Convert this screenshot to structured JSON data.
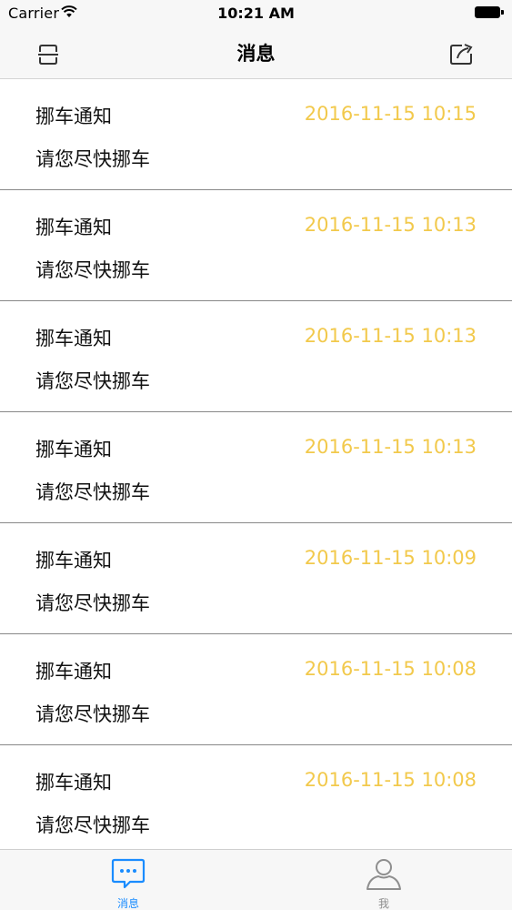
{
  "status_bar": {
    "carrier": "Carrier",
    "time": "10:21 AM"
  },
  "nav": {
    "title": "消息",
    "left_icon": "scan-icon",
    "right_icon": "share-icon"
  },
  "messages": [
    {
      "title": "挪车通知",
      "time": "2016-11-15 10:15",
      "text": "请您尽快挪车"
    },
    {
      "title": "挪车通知",
      "time": "2016-11-15 10:13",
      "text": "请您尽快挪车"
    },
    {
      "title": "挪车通知",
      "time": "2016-11-15 10:13",
      "text": "请您尽快挪车"
    },
    {
      "title": "挪车通知",
      "time": "2016-11-15 10:13",
      "text": "请您尽快挪车"
    },
    {
      "title": "挪车通知",
      "time": "2016-11-15 10:09",
      "text": "请您尽快挪车"
    },
    {
      "title": "挪车通知",
      "time": "2016-11-15 10:08",
      "text": "请您尽快挪车"
    },
    {
      "title": "挪车通知",
      "time": "2016-11-15 10:08",
      "text": "请您尽快挪车"
    }
  ],
  "tabs": [
    {
      "label": "消息",
      "icon": "chat-bubble-icon",
      "active": true
    },
    {
      "label": "我",
      "icon": "person-icon",
      "active": false
    }
  ],
  "colors": {
    "timestamp": "#f2c94c",
    "active_tab": "#1a8cff",
    "inactive_tab": "#8e8e8e"
  }
}
